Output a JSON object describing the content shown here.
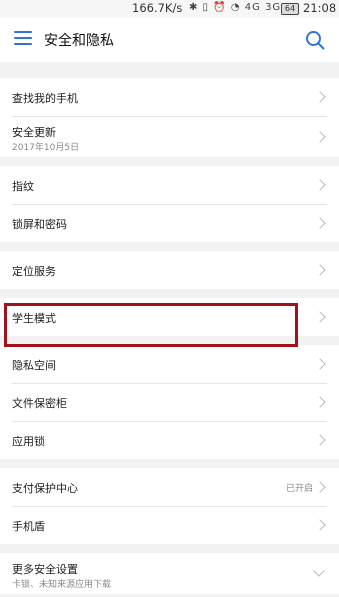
{
  "status_bar": {
    "net_speed": "166.7K/s",
    "icons": "✱ ▯ ⏰ ◔ 4G 3G",
    "battery": "64",
    "time": "21:08"
  },
  "app_bar": {
    "title": "安全和隐私"
  },
  "groups": [
    {
      "items": [
        {
          "label": "查找我的手机"
        },
        {
          "label": "安全更新",
          "sub": "2017年10月5日"
        }
      ]
    },
    {
      "items": [
        {
          "label": "指纹"
        },
        {
          "label": "锁屏和密码"
        }
      ]
    },
    {
      "items": [
        {
          "label": "定位服务"
        }
      ]
    },
    {
      "items": [
        {
          "label": "学生模式"
        }
      ]
    },
    {
      "items": [
        {
          "label": "隐私空间"
        },
        {
          "label": "文件保密柜"
        },
        {
          "label": "应用锁"
        }
      ]
    },
    {
      "items": [
        {
          "label": "支付保护中心",
          "value": "已开启"
        },
        {
          "label": "手机盾"
        }
      ]
    },
    {
      "items": [
        {
          "label": "更多安全设置",
          "sub": "卡锁、未知来源应用下载"
        }
      ]
    }
  ],
  "colors": {
    "accent": "#2f73d8",
    "highlight_box": "#a3121c"
  },
  "icons": {
    "menu": "menu-icon",
    "search": "search-icon",
    "row_arrow": "chevron-right-icon",
    "expand": "chevron-down-icon"
  }
}
